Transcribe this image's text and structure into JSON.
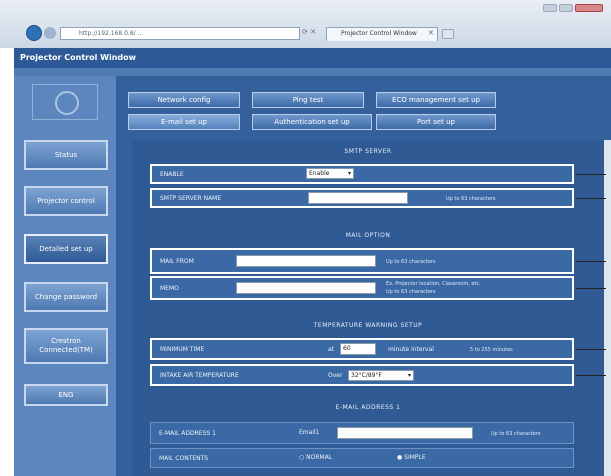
{
  "browser": {
    "address": "http://192.168.0.8/ ...",
    "tab_title": "Projector Control Window"
  },
  "app": {
    "title": "Projector Control Window"
  },
  "sidebar": {
    "items": [
      {
        "label": "Status"
      },
      {
        "label": "Projector control"
      },
      {
        "label": "Detailed set up"
      },
      {
        "label": "Change password"
      },
      {
        "label": "Crestron Connected(TM)"
      },
      {
        "label": "ENG"
      }
    ]
  },
  "tabs": {
    "row1": [
      "Network config",
      "Ping test",
      "ECO management set up"
    ],
    "row2": [
      "E-mail set up",
      "Authentication set up",
      "Port set up"
    ]
  },
  "smtp": {
    "title": "SMTP SERVER",
    "enable_label": "ENABLE",
    "enable_value": "Enable",
    "server_label": "SMTP SERVER NAME",
    "server_value": "",
    "server_note": "Up to 63 characters"
  },
  "mail_option": {
    "title": "MAIL OPTION",
    "from_label": "MAIL FROM",
    "from_value": "",
    "from_note": "Up to 63 characters",
    "memo_label": "MEMO",
    "memo_value": "",
    "memo_note_1": "Ex. Projector location, Classroom, etc.",
    "memo_note_2": "Up to 63 characters"
  },
  "temperature": {
    "title": "TEMPERATURE WARNING SETUP",
    "interval_label": "MINIMUM TIME",
    "interval_prefix": "at",
    "interval_value": "60",
    "interval_unit": "minute interval",
    "interval_range": "5 to 255 minutes",
    "intake_label": "INTAKE AIR TEMPERATURE",
    "intake_prefix": "Over",
    "intake_value": "32°C/89°F"
  },
  "email1": {
    "title": "E-MAIL ADDRESS 1",
    "address_label": "E-MAIL ADDRESS 1",
    "address_prefix": "Email1",
    "address_value": "",
    "address_note": "Up to 63 characters",
    "contents_label": "MAIL CONTENTS",
    "normal": "NORMAL",
    "simple": "SIMPLE"
  }
}
